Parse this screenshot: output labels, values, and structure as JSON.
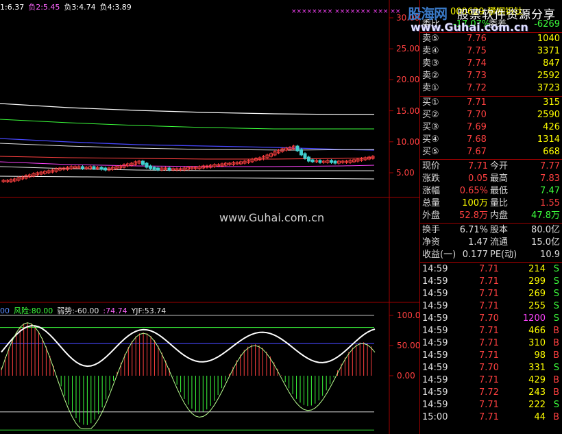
{
  "top_indicator": [
    {
      "text": "1:6.37",
      "color": "#ffffff"
    },
    {
      "text": "负2:5.45",
      "color": "#ff66ff"
    },
    {
      "text": "负3:4.74",
      "color": "#ffffff"
    },
    {
      "text": "负4:3.89",
      "color": "#ffffff"
    }
  ],
  "price_axis": [
    "30.00",
    "25.00",
    "20.00",
    "15.00",
    "10.00",
    "5.00"
  ],
  "markers": "××××××××  ×××××××   ×××   ××",
  "lower_indicator": [
    {
      "text": "00",
      "color": "#5a8cff"
    },
    {
      "text": "风险:80.00",
      "color": "#3cff3c"
    },
    {
      "text": "弱势:-60.00",
      "color": "#e0e0e0"
    },
    {
      "text": ":74.74",
      "color": "#ff66ff"
    },
    {
      "text": "YJF:53.74",
      "color": "#e0e0e0"
    }
  ],
  "osc_axis": [
    "100.0",
    "50.00",
    "0.00"
  ],
  "watermark": "www.Guhai.com.cn",
  "logo": {
    "brand": "股海网",
    "slogan": "股票软件资源分享",
    "url": "www.Guhai.com.cn"
  },
  "header_partial": {
    "code": "000629",
    "name": "攀钢钒钛",
    "line2_label": "委比",
    "line2_value": "-17.07%",
    "line2_label2": "委差",
    "line2_value2": "-6269"
  },
  "order_book": {
    "asks": [
      {
        "label": "卖⑤",
        "price": "7.76",
        "vol": "1040"
      },
      {
        "label": "卖④",
        "price": "7.75",
        "vol": "3371"
      },
      {
        "label": "卖③",
        "price": "7.74",
        "vol": "847"
      },
      {
        "label": "卖②",
        "price": "7.73",
        "vol": "2592"
      },
      {
        "label": "卖①",
        "price": "7.72",
        "vol": "3723"
      }
    ],
    "bids": [
      {
        "label": "买①",
        "price": "7.71",
        "vol": "315"
      },
      {
        "label": "买②",
        "price": "7.70",
        "vol": "2590"
      },
      {
        "label": "买③",
        "price": "7.69",
        "vol": "426"
      },
      {
        "label": "买④",
        "price": "7.68",
        "vol": "1314"
      },
      {
        "label": "买⑤",
        "price": "7.67",
        "vol": "668"
      }
    ]
  },
  "stats": [
    {
      "l1": "现价",
      "v1": "7.71",
      "c1": "#ff4040",
      "l2": "今开",
      "v2": "7.77",
      "c2": "#ff4040"
    },
    {
      "l1": "涨跌",
      "v1": "0.05",
      "c1": "#ff4040",
      "l2": "最高",
      "v2": "7.83",
      "c2": "#ff4040"
    },
    {
      "l1": "涨幅",
      "v1": "0.65%",
      "c1": "#ff4040",
      "l2": "最低",
      "v2": "7.47",
      "c2": "#3cff3c"
    },
    {
      "l1": "总量",
      "v1": "100万",
      "c1": "#ffff00",
      "l2": "量比",
      "v2": "1.55",
      "c2": "#ff4040"
    },
    {
      "l1": "外盘",
      "v1": "52.8万",
      "c1": "#ff4040",
      "l2": "内盘",
      "v2": "47.8万",
      "c2": "#3cff3c"
    }
  ],
  "fundamentals": [
    {
      "l1": "换手",
      "v1": "6.71%",
      "l2": "股本",
      "v2": "80.0亿"
    },
    {
      "l1": "净资",
      "v1": "1.47",
      "l2": "流通",
      "v2": "15.0亿"
    },
    {
      "l1": "收益(一)",
      "v1": "0.177",
      "l2": "PE(动)",
      "v2": "10.9"
    }
  ],
  "ticks": [
    {
      "time": "14:59",
      "price": "7.71",
      "vol": "214",
      "side": "S",
      "vcolor": "#ffff00"
    },
    {
      "time": "14:59",
      "price": "7.71",
      "vol": "299",
      "side": "S",
      "vcolor": "#ffff00"
    },
    {
      "time": "14:59",
      "price": "7.71",
      "vol": "269",
      "side": "S",
      "vcolor": "#ffff00"
    },
    {
      "time": "14:59",
      "price": "7.71",
      "vol": "255",
      "side": "S",
      "vcolor": "#ffff00"
    },
    {
      "time": "14:59",
      "price": "7.70",
      "vol": "1200",
      "side": "S",
      "vcolor": "#ff44ff"
    },
    {
      "time": "14:59",
      "price": "7.71",
      "vol": "466",
      "side": "B",
      "vcolor": "#ffff00"
    },
    {
      "time": "14:59",
      "price": "7.71",
      "vol": "310",
      "side": "B",
      "vcolor": "#ffff00"
    },
    {
      "time": "14:59",
      "price": "7.71",
      "vol": "98",
      "side": "B",
      "vcolor": "#ffff00"
    },
    {
      "time": "14:59",
      "price": "7.70",
      "vol": "331",
      "side": "S",
      "vcolor": "#ffff00"
    },
    {
      "time": "14:59",
      "price": "7.71",
      "vol": "429",
      "side": "B",
      "vcolor": "#ffff00"
    },
    {
      "time": "14:59",
      "price": "7.72",
      "vol": "243",
      "side": "B",
      "vcolor": "#ffff00"
    },
    {
      "time": "14:59",
      "price": "7.71",
      "vol": "222",
      "side": "S",
      "vcolor": "#ffff00"
    },
    {
      "time": "15:00",
      "price": "7.71",
      "vol": "44",
      "side": "B",
      "vcolor": "#ffff00"
    }
  ],
  "colors": {
    "up": "#ff4040",
    "down": "#3cff3c",
    "grid": "#a00000",
    "side_s": "#3cff3c",
    "side_b": "#ff4040"
  }
}
